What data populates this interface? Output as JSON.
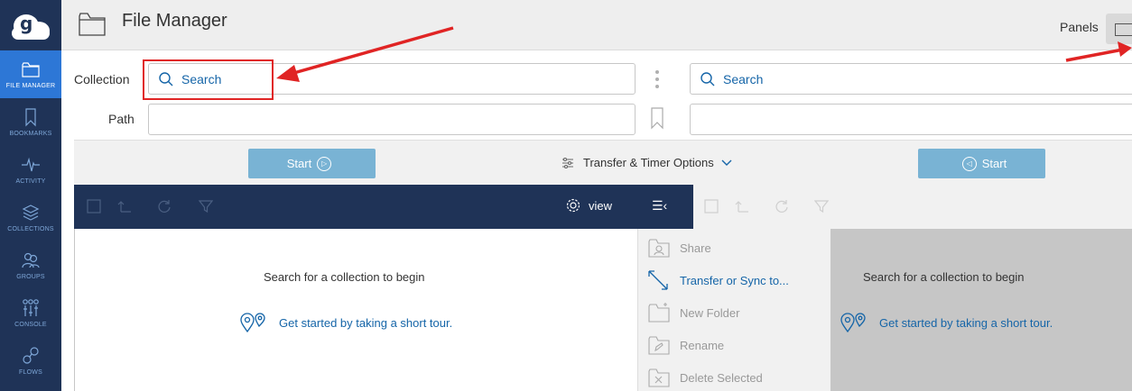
{
  "app": {
    "title": "File Manager",
    "panels_label": "Panels"
  },
  "sidebar": {
    "items": [
      {
        "label": "FILE MANAGER",
        "icon": "folder-icon",
        "active": true
      },
      {
        "label": "BOOKMARKS",
        "icon": "bookmark-icon",
        "active": false
      },
      {
        "label": "ACTIVITY",
        "icon": "activity-icon",
        "active": false
      },
      {
        "label": "COLLECTIONS",
        "icon": "collections-icon",
        "active": false
      },
      {
        "label": "GROUPS",
        "icon": "groups-icon",
        "active": false
      },
      {
        "label": "CONSOLE",
        "icon": "console-icon",
        "active": false
      },
      {
        "label": "FLOWS",
        "icon": "flows-icon",
        "active": false
      }
    ]
  },
  "fields": {
    "collection_label": "Collection",
    "path_label": "Path",
    "left_search_placeholder": "Search",
    "right_search_placeholder": "Search"
  },
  "startbar": {
    "left_start": "Start",
    "right_start": "Start",
    "transfer_options": "Transfer & Timer Options"
  },
  "toolbar": {
    "view_label": "view",
    "menu_toggle": "☰‹"
  },
  "left_panel": {
    "empty_message": "Search for a collection to begin",
    "tour_link": "Get started by taking a short tour."
  },
  "right_panel": {
    "empty_message": "Search for a collection to begin",
    "tour_link": "Get started by taking a short tour."
  },
  "context_menu": {
    "items": [
      {
        "label": "Share",
        "enabled": false
      },
      {
        "label": "Transfer or Sync to...",
        "enabled": true
      },
      {
        "label": "New Folder",
        "enabled": false
      },
      {
        "label": "Rename",
        "enabled": false
      },
      {
        "label": "Delete Selected",
        "enabled": false
      }
    ]
  },
  "colors": {
    "sidebar_bg": "#1f3357",
    "active_nav": "#2d77d6",
    "link_blue": "#1565a8",
    "start_button": "#79b3d4",
    "annotation_red": "#e02424"
  }
}
